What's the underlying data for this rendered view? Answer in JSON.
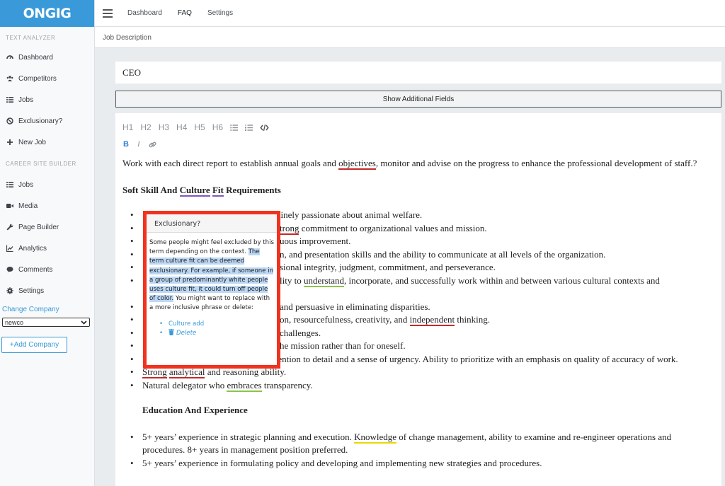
{
  "app": {
    "logo": "ONGIG"
  },
  "sidebar": {
    "section1": "TEXT ANALYZER",
    "items1": [
      {
        "label": "Dashboard",
        "icon": "dashboard-icon"
      },
      {
        "label": "Competitors",
        "icon": "users-icon"
      },
      {
        "label": "Jobs",
        "icon": "list-icon"
      },
      {
        "label": "Exclusionary?",
        "icon": "ban-icon"
      },
      {
        "label": "New Job",
        "icon": "plus-icon"
      }
    ],
    "section2": "CAREER SITE BUILDER",
    "items2": [
      {
        "label": "Jobs",
        "icon": "list-icon"
      },
      {
        "label": "Media",
        "icon": "video-icon"
      },
      {
        "label": "Page Builder",
        "icon": "wrench-icon"
      },
      {
        "label": "Analytics",
        "icon": "chart-icon"
      },
      {
        "label": "Comments",
        "icon": "comment-icon"
      },
      {
        "label": "Settings",
        "icon": "gear-icon"
      }
    ],
    "change_company": "Change Company",
    "company_select": "newco",
    "add_company": "+Add Company"
  },
  "topbar": {
    "nav": [
      "Dashboard",
      "FAQ",
      "Settings"
    ]
  },
  "breadcrumb": "Job Description",
  "job_title": "CEO",
  "show_fields": "Show Additional Fields",
  "toolbar": {
    "headings": [
      "H1",
      "H2",
      "H3",
      "H4",
      "H5",
      "H6"
    ],
    "bold": "B",
    "italic": "I"
  },
  "content": {
    "p1_a": "Work with each direct report to establish annual goals and ",
    "p1_b": "objectives",
    "p1_c": ", monitor and advise on the progress to enhance the professional development of staff.?",
    "heading_soft_a": "Soft Skill And ",
    "heading_soft_b": "Culture",
    "heading_soft_c": " ",
    "heading_soft_d": "Fit",
    "heading_soft_e": " Requirements",
    "bullets": {
      "b1": "ems thinker genuinely passionate about animal welfare.",
      "b2a": "trong",
      "b2b": " commitment to organizational values and mission.",
      "b3": "uous improvement.",
      "b4": "n, and presentation skills and the ability to communicate at all levels of the organization.",
      "b5": "sional integrity, judgment, commitment, and perseverance.",
      "b6a": "lity to ",
      "b6b": "understand",
      "b6c": ", incorporate, and successfully work within and between various cultural contexts and",
      "b6d": "",
      "b7": "and persuasive in eliminating disparities.",
      "b8a": "on, resourcefulness, creativity, and ",
      "b8b": "independent",
      "b8c": " thinking.",
      "b9": "challenges.",
      "b10": "he mission rather than for oneself.",
      "b11": "Discerning listener with excellent attention to detail and a sense of urgency. Ability to prioritize with an emphasis on quality of accuracy of work.",
      "b12a": "Strong",
      "b12b": " ",
      "b12c": "analytical",
      "b12d": " and reasoning ability.",
      "b13a": "Natural delegator who ",
      "b13b": "embraces",
      "b13c": " transparency."
    },
    "heading_edu": "Education And Experience",
    "edu": {
      "e1a": "5+ years’ experience in strategic planning and execution. ",
      "e1b": "Knowledge",
      "e1c": " of change management, ability to examine and re-engineer operations and procedures. 8+ years in management position preferred.",
      "e2": "5+ years’ experience in formulating policy and developing and implementing new strategies and procedures."
    }
  },
  "popup": {
    "title": "Exclusionary?",
    "text_a": "Some people might feel excluded by this term depending on the context. ",
    "text_hl": "The term culture fit can be deemed exclusionary. For example, if someone in a group of predominantly white people uses culture fit, it could turn off people of color.",
    "text_b": " You might want to replace with a more inclusive phrase or delete:",
    "option1": "Culture add",
    "option2": "Delete"
  },
  "colors": {
    "accent": "#3a9ad9",
    "popup_border": "#f0321f",
    "underline_red": "#c62828",
    "underline_green": "#8bc34a",
    "underline_purple": "#7e57c2",
    "highlight": "#bcd8f5"
  }
}
